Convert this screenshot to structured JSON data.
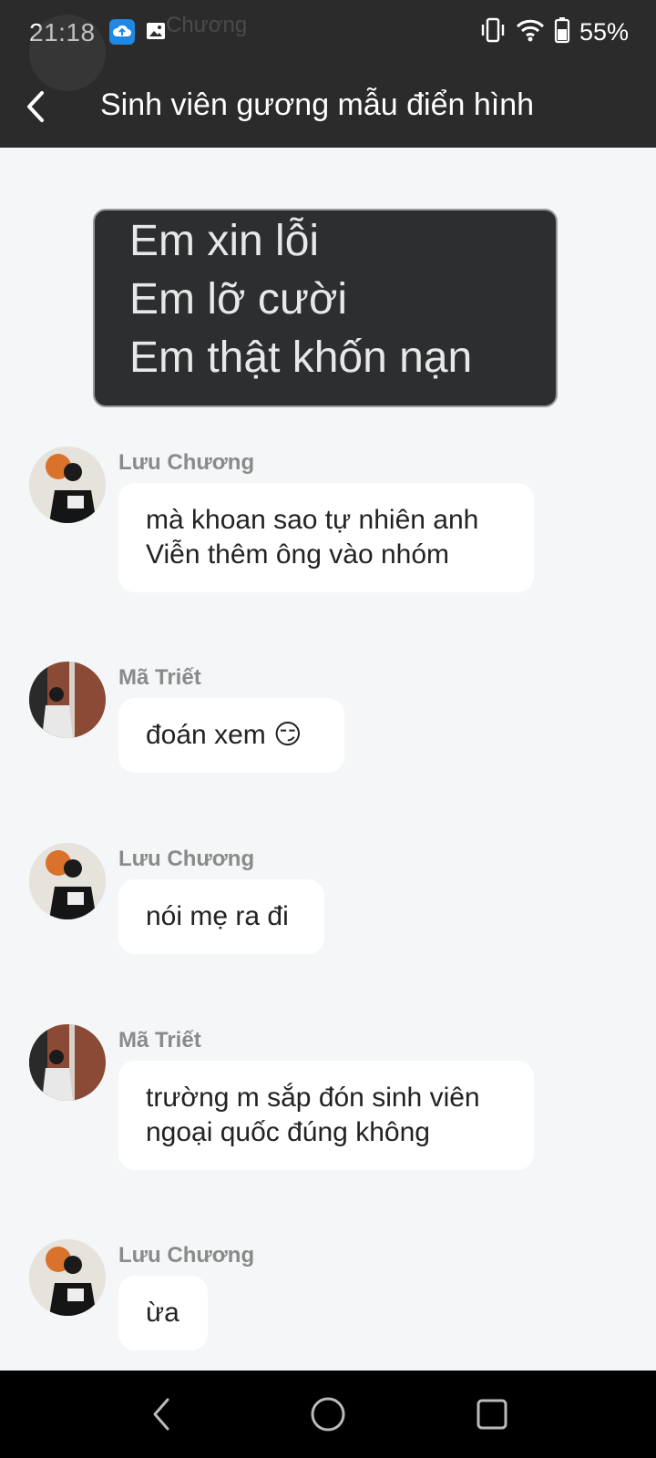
{
  "status_bar": {
    "time": "21:18",
    "battery": "55%"
  },
  "header": {
    "title": "Sinh viên gương mẫu điển hình",
    "ghost_name": "Chương"
  },
  "sticker": {
    "lines": [
      "Em xin lỗi",
      "Em lỡ cười",
      "Em thật khốn nạn"
    ]
  },
  "messages": [
    {
      "sender": "Lưu Chương",
      "lines": [
        "mà khoan sao tự nhiên anh",
        "Viễn thêm ông vào nhóm"
      ]
    },
    {
      "sender": "Mã Triết",
      "lines": [
        "đoán xem 😏"
      ]
    },
    {
      "sender": "Lưu Chương",
      "lines": [
        "nói mẹ ra đi"
      ]
    },
    {
      "sender": "Mã Triết",
      "lines": [
        "trường m sắp đón sinh viên",
        "ngoại quốc đúng không"
      ]
    },
    {
      "sender": "Lưu Chương",
      "lines": [
        "ừa"
      ]
    }
  ],
  "colors": {
    "header_bg": "#2b2b2b",
    "chat_bg": "#f5f6f8",
    "bubble_bg": "#ffffff",
    "sender_name": "#8a8a8a"
  },
  "icons": [
    "back-arrow-icon",
    "vibrate-icon",
    "wifi-icon",
    "battery-icon",
    "nav-back-icon",
    "nav-home-icon",
    "nav-recents-icon"
  ]
}
